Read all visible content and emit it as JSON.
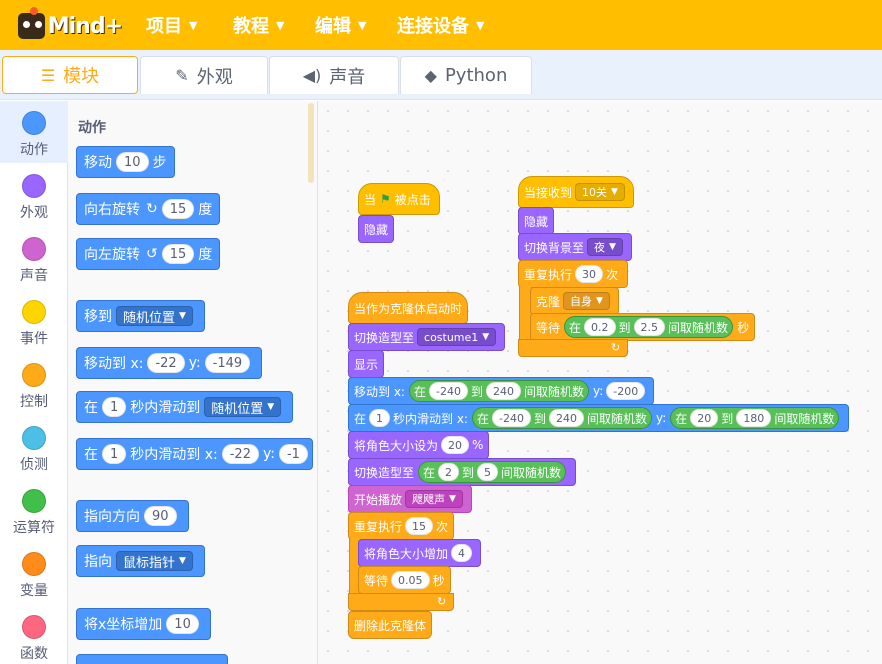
{
  "app": {
    "logo_text": "Mind+",
    "menus": [
      "项目",
      "教程",
      "编辑",
      "连接设备"
    ]
  },
  "tabs": {
    "blocks": "模块",
    "costumes": "外观",
    "sounds": "声音",
    "python": "Python"
  },
  "categories": [
    {
      "label": "动作",
      "color": "#4c97ff"
    },
    {
      "label": "外观",
      "color": "#9966ff"
    },
    {
      "label": "声音",
      "color": "#cf63cf"
    },
    {
      "label": "事件",
      "color": "#ffd500"
    },
    {
      "label": "控制",
      "color": "#ffab19"
    },
    {
      "label": "侦测",
      "color": "#4cbfe6"
    },
    {
      "label": "运算符",
      "color": "#40bf4a"
    },
    {
      "label": "变量",
      "color": "#ff8c1a"
    },
    {
      "label": "函数",
      "color": "#ff6680"
    }
  ],
  "palette": {
    "title": "动作",
    "move": {
      "label": "移动",
      "steps": "10",
      "suffix": "步"
    },
    "turn_right": {
      "label": "向右旋转",
      "deg": "15",
      "suffix": "度"
    },
    "turn_left": {
      "label": "向左旋转",
      "deg": "15",
      "suffix": "度"
    },
    "goto": {
      "label": "移到",
      "target": "随机位置"
    },
    "goto_xy": {
      "label": "移动到 x:",
      "x": "-22",
      "ylabel": "y:",
      "y": "-149"
    },
    "glide_to": {
      "pre": "在",
      "secs": "1",
      "mid": "秒内滑动到",
      "target": "随机位置"
    },
    "glide_xy": {
      "pre": "在",
      "secs": "1",
      "mid": "秒内滑动到 x:",
      "x": "-22",
      "ylabel": "y:",
      "y": "-1"
    },
    "point_dir": {
      "label": "指向方向",
      "dir": "90"
    },
    "point_to": {
      "label": "指向",
      "target": "鼠标指针"
    },
    "change_x": {
      "label": "将x坐标增加",
      "val": "10"
    }
  },
  "script1": {
    "hat_pre": "当",
    "hat_post": "被点击",
    "hide": "隐藏"
  },
  "script2": {
    "hat": "当接收到",
    "msg": "10关",
    "hide": "隐藏",
    "switch_bg": "切换背景至",
    "bg": "夜",
    "repeat": "重复执行",
    "repeat_n": "30",
    "repeat_suffix": "次",
    "clone": "克隆",
    "clone_target": "自身",
    "wait": "等待",
    "op_pre": "在",
    "op_a": "0.2",
    "op_mid": "到",
    "op_b": "2.5",
    "op_post": "间取随机数",
    "wait_suffix": "秒"
  },
  "script3": {
    "hat": "当作为克隆体启动时",
    "switch_costume": "切换造型至",
    "costume": "costume1",
    "show": "显示",
    "goto_x": "移动到 x:",
    "r1_pre": "在",
    "r1_a": "-240",
    "r1_mid": "到",
    "r1_b": "240",
    "r1_post": "间取随机数",
    "goto_y_label": "y:",
    "goto_y": "-200",
    "glide_pre": "在",
    "glide_secs": "1",
    "glide_mid": "秒内滑动到 x:",
    "r2_pre": "在",
    "r2_a": "-240",
    "r2_mid": "到",
    "r2_b": "240",
    "r2_post": "间取随机数",
    "glide_y_label": "y:",
    "r3_pre": "在",
    "r3_a": "20",
    "r3_mid": "到",
    "r3_b": "180",
    "r3_post": "间取随机数",
    "set_size": "将角色大小设为",
    "size_val": "20",
    "size_suffix": "%",
    "switch_costume2": "切换造型至",
    "r4_pre": "在",
    "r4_a": "2",
    "r4_mid": "到",
    "r4_b": "5",
    "r4_post": "间取随机数",
    "play_sound": "开始播放",
    "sound": "飕飕声",
    "repeat": "重复执行",
    "repeat_n": "15",
    "repeat_suffix": "次",
    "change_size": "将角色大小增加",
    "change_val": "4",
    "wait": "等待",
    "wait_val": "0.05",
    "wait_suffix": "秒",
    "delete_clone": "删除此克隆体"
  }
}
